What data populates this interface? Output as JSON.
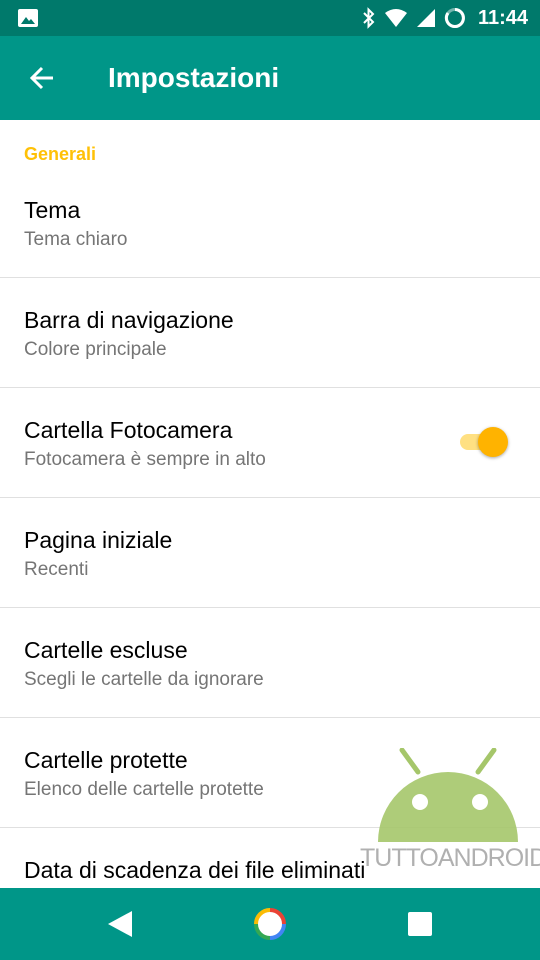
{
  "status_bar": {
    "time": "11:44",
    "icons": [
      "gallery-icon",
      "bluetooth-icon",
      "wifi-icon",
      "cell-signal-icon",
      "battery-icon"
    ]
  },
  "app_bar": {
    "title": "Impostazioni",
    "back_icon": "arrow-back-icon"
  },
  "settings": {
    "section_header": "Generali",
    "items": [
      {
        "title": "Tema",
        "summary": "Tema chiaro"
      },
      {
        "title": "Barra di navigazione",
        "summary": "Colore principale"
      },
      {
        "title": "Cartella Fotocamera",
        "summary": "Fotocamera è sempre in alto",
        "toggle": true
      },
      {
        "title": "Pagina iniziale",
        "summary": "Recenti"
      },
      {
        "title": "Cartelle escluse",
        "summary": "Scegli le cartelle da ignorare"
      },
      {
        "title": "Cartelle protette",
        "summary": "Elenco delle cartelle protette"
      },
      {
        "title": "Data di scadenza dei file eliminati",
        "summary": ""
      }
    ]
  },
  "watermark": {
    "text": "TUTTOANDROID"
  },
  "nav_bar": {
    "icons": [
      "back-triangle-icon",
      "home-circle-icon",
      "recents-square-icon"
    ]
  },
  "colors": {
    "status_bar": "#00796b",
    "app_bar": "#009688",
    "accent": "#ffc107",
    "toggle_thumb": "#ffb300",
    "toggle_track": "#ffe082"
  }
}
